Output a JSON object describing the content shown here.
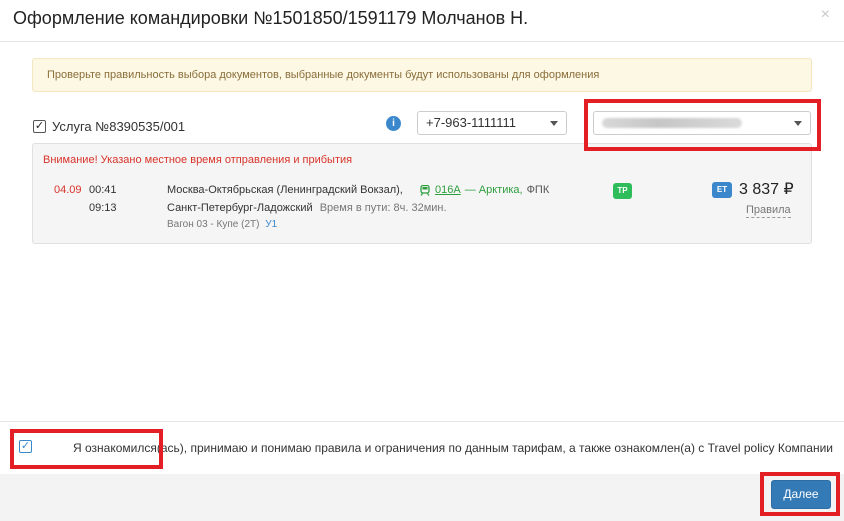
{
  "modal": {
    "title": "Оформление командировки №1501850/1591179 Молчанов Н.",
    "close_label": "×"
  },
  "alert": {
    "text": "Проверьте правильность выбора документов, выбранные документы будут использованы для оформления"
  },
  "service": {
    "checked": true,
    "label": "Услуга №8390535/001",
    "info_icon": "info-icon",
    "phone_value": "+7-963-1111111",
    "person_value_redacted": true
  },
  "trip": {
    "warning": "Внимание! Указано местное время отправления и прибытия",
    "date": "04.09",
    "depart_time": "00:41",
    "arrive_time": "09:13",
    "from_station": "Москва-Октябрьская (Ленинградский Вокзал),",
    "train_number": "016А",
    "train_name": "— Арктика,",
    "train_operator": "ФПК",
    "to_station": "Санкт-Петербург-Ладожский",
    "duration": "Время в пути: 8ч. 32мин.",
    "wagon": "Вагон 03 - Купе (2Т)",
    "wagon_class": "У1",
    "badge_tp": "TP",
    "badge_et": "ET",
    "price": "3 837 ₽",
    "rules_link": "Правила"
  },
  "footer": {
    "agree_checked": true,
    "agree_text": "Я ознакомился(ась), принимаю и понимаю правила и ограничения по данным тарифам, а также ознакомлен(а) с Travel policy Компании",
    "next_label": "Далее"
  },
  "colors": {
    "accent": "#337ab7",
    "highlight": "#e31e24",
    "warning_text": "#d9332a",
    "train_green": "#2e9e3e"
  }
}
